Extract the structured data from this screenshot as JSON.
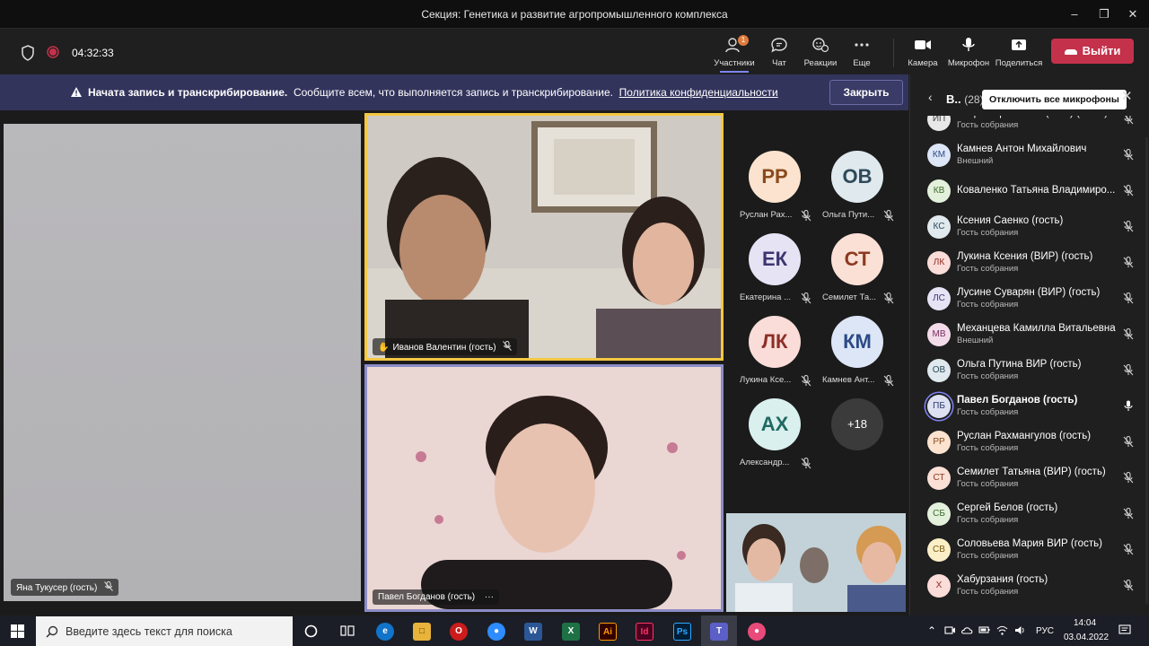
{
  "window": {
    "title": "Секция: Генетика и развитие агропромышленного комплекса"
  },
  "toolbar": {
    "timer": "04:32:33",
    "participants_label": "Участники",
    "participants_badge": "1",
    "chat_label": "Чат",
    "reactions_label": "Реакции",
    "more_label": "Еще",
    "camera_label": "Камера",
    "mic_label": "Микрофон",
    "share_label": "Поделиться",
    "leave_label": "Выйти",
    "leave_color": "#c4314b"
  },
  "banner": {
    "bold": "Начата запись и транскрибирование.",
    "text": "Сообщите всем, что выполняется запись и транскрибирование.",
    "link": "Политика конфиденциальности",
    "close": "Закрыть"
  },
  "video_tiles": {
    "left": "Яна Тукусер (гость)",
    "top": "Иванов Валентин (гость)",
    "bottom": "Павел Богданов (гость)",
    "bottom_more": "···"
  },
  "avatar_grid": [
    {
      "initials": "РР",
      "name": "Руслан Рах...",
      "bg": "#fbe3cf",
      "fg": "#8a4a1e"
    },
    {
      "initials": "ОВ",
      "name": "Ольга Пути...",
      "bg": "#dfe9ee",
      "fg": "#2e4a5a"
    },
    {
      "initials": "ЕК",
      "name": "Екатерина ...",
      "bg": "#e6e3f5",
      "fg": "#3c3570"
    },
    {
      "initials": "СТ",
      "name": "Семилет Та...",
      "bg": "#fbe0d6",
      "fg": "#8c3a21"
    },
    {
      "initials": "ЛК",
      "name": "Лукина Ксе...",
      "bg": "#fadcd8",
      "fg": "#8d2e25"
    },
    {
      "initials": "КМ",
      "name": "Камнев Ант...",
      "bg": "#dde6f6",
      "fg": "#2b4a86"
    },
    {
      "initials": "АХ",
      "name": "Александр...",
      "bg": "#daf0ee",
      "fg": "#1f6a63"
    },
    {
      "initials": "+18",
      "name": "",
      "bg": "#3b3b3b",
      "fg": "#ffffff"
    }
  ],
  "panel": {
    "title": "В..",
    "count": "(28)",
    "mute_all": "Отключить все микрофоны",
    "participants": [
      {
        "initials": "ИП",
        "name": "Игорь Коротенков (ВИР) (гость)",
        "role": "Гость собрания",
        "bg": "#e8e8e8",
        "fg": "#444"
      },
      {
        "initials": "КМ",
        "name": "Камнев Антон Михайлович",
        "role": "Внешний",
        "bg": "#dde6f6",
        "fg": "#2b4a86"
      },
      {
        "initials": "КВ",
        "name": "Коваленко Татьяна Владимиро...",
        "role": "",
        "bg": "#e3f1dc",
        "fg": "#3d6a2a"
      },
      {
        "initials": "КС",
        "name": "Ксения Саенко (гость)",
        "role": "Гость собрания",
        "bg": "#dfe9ee",
        "fg": "#2e4a5a"
      },
      {
        "initials": "ЛК",
        "name": "Лукина Ксения (ВИР) (гость)",
        "role": "Гость собрания",
        "bg": "#fadcd8",
        "fg": "#8d2e25"
      },
      {
        "initials": "ЛС",
        "name": "Лусине Суварян (ВИР) (гость)",
        "role": "Гость собрания",
        "bg": "#e6e3f5",
        "fg": "#3c3570"
      },
      {
        "initials": "МВ",
        "name": "Механцева Камилла Витальевна",
        "role": "Внешний",
        "bg": "#f3dcea",
        "fg": "#7a2d5e"
      },
      {
        "initials": "ОВ",
        "name": "Ольга Путина ВИР (гость)",
        "role": "Гость собрания",
        "bg": "#dfe9ee",
        "fg": "#2e4a5a"
      },
      {
        "initials": "ПБ",
        "name": "Павел Богданов (гость)",
        "role": "Гость собрания",
        "bg": "#dde1f2",
        "fg": "#2b3a6a"
      },
      {
        "initials": "РР",
        "name": "Руслан Рахмангулов (гость)",
        "role": "Гость собрания",
        "bg": "#fbe3cf",
        "fg": "#8a4a1e"
      },
      {
        "initials": "СТ",
        "name": "Семилет Татьяна (ВИР) (гость)",
        "role": "Гость собрания",
        "bg": "#fbe0d6",
        "fg": "#8c3a21"
      },
      {
        "initials": "СБ",
        "name": "Сергей Белов (гость)",
        "role": "Гость собрания",
        "bg": "#e3f1dc",
        "fg": "#3d6a2a"
      },
      {
        "initials": "СВ",
        "name": "Соловьева Мария ВИР (гость)",
        "role": "Гость собрания",
        "bg": "#fbefc8",
        "fg": "#7a5a10"
      },
      {
        "initials": "Х",
        "name": "Хабурзания (гость)",
        "role": "Гость собрания",
        "bg": "#fadcd8",
        "fg": "#8d2e25"
      }
    ]
  },
  "taskbar": {
    "search_placeholder": "Введите здесь текст для поиска",
    "lang": "РУС",
    "time": "14:04",
    "date": "03.04.2022"
  }
}
